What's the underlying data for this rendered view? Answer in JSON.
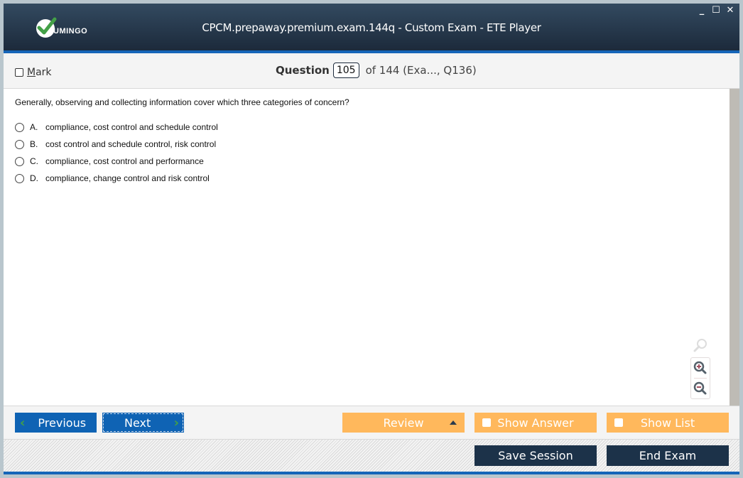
{
  "window": {
    "title": "CPCM.prepaway.premium.exam.144q - Custom Exam - ETE Player",
    "logo_text": "UMINGO",
    "controls": {
      "minimize": "_",
      "maximize": "☐",
      "close": "✕"
    }
  },
  "question_bar": {
    "mark_label_underlined": "M",
    "mark_label_rest": "ark",
    "mark_checked": false,
    "question_label": "Question",
    "question_number": "105",
    "of_text": "of 144 (Exa..., Q136)"
  },
  "question": {
    "text": "Generally, observing and collecting information cover which three categories of concern?",
    "options": [
      {
        "letter": "A.",
        "text": "compliance, cost control and schedule control",
        "selected": false
      },
      {
        "letter": "B.",
        "text": "cost control and schedule control, risk control",
        "selected": false
      },
      {
        "letter": "C.",
        "text": "compliance, cost control and performance",
        "selected": false
      },
      {
        "letter": "D.",
        "text": "compliance, change control and risk control",
        "selected": false
      }
    ]
  },
  "zoom_tools": {
    "icons": [
      "search-icon",
      "zoom-in-icon",
      "zoom-out-icon"
    ]
  },
  "nav": {
    "previous_label": "Previous",
    "next_label": "Next",
    "review_label": "Review",
    "show_answer_label": "Show Answer",
    "show_list_label": "Show List"
  },
  "footer": {
    "save_session_label": "Save Session",
    "end_exam_label": "End Exam"
  },
  "colors": {
    "titlebar": "#1c2a3b",
    "accent_blue": "#0f63b4",
    "orange": "#ffb85c",
    "dark_button": "#1c3249",
    "check_green": "#43a047"
  }
}
